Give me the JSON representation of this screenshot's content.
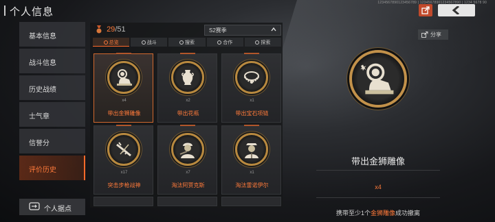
{
  "header": {
    "title": "个人信息",
    "tiny_text": "1234567890123456789 | 12345678901234567890 | 1234 5678 90"
  },
  "sidebar": {
    "items": [
      {
        "label": "基本信息"
      },
      {
        "label": "战斗信息"
      },
      {
        "label": "历史战绩"
      },
      {
        "label": "士气章"
      },
      {
        "label": "信誉分"
      },
      {
        "label": "评价历史"
      }
    ],
    "active_index": 5,
    "base_button": "个人据点"
  },
  "collection": {
    "count_current": "29",
    "count_sep": "/",
    "count_total": "51",
    "season": "S2赛季",
    "tabs": [
      {
        "label": "总览",
        "icon": "overview-icon"
      },
      {
        "label": "战斗",
        "icon": "combat-icon"
      },
      {
        "label": "搜索",
        "icon": "search-icon"
      },
      {
        "label": "合作",
        "icon": "coop-icon"
      },
      {
        "label": "探索",
        "icon": "explore-icon"
      }
    ],
    "cards": [
      {
        "name": "带出金狮雕像",
        "mult": "x4",
        "icon": "lion-statue-icon"
      },
      {
        "name": "带出花瓶",
        "mult": "x2",
        "icon": "vase-icon"
      },
      {
        "name": "带出宝石项链",
        "mult": "x1",
        "icon": "necklace-icon"
      },
      {
        "name": "突击步枪战神",
        "mult": "x17",
        "icon": "rifle-icon"
      },
      {
        "name": "淘汰阿贾克斯",
        "mult": "x7",
        "icon": "soldier-icon"
      },
      {
        "name": "淘汰雷诺伊尔",
        "mult": "x1",
        "icon": "officer-icon"
      }
    ]
  },
  "detail": {
    "share": "分享",
    "title": "带出金狮雕像",
    "mult": "x4",
    "desc_pre": "携带至少1个",
    "desc_highlight": "金狮雕像",
    "desc_post": "成功撤离",
    "icon": "lion-statue-icon"
  },
  "colors": {
    "accent": "#ff7a3a",
    "gold": "#b8893f",
    "export_btn": "#c14a2c"
  }
}
